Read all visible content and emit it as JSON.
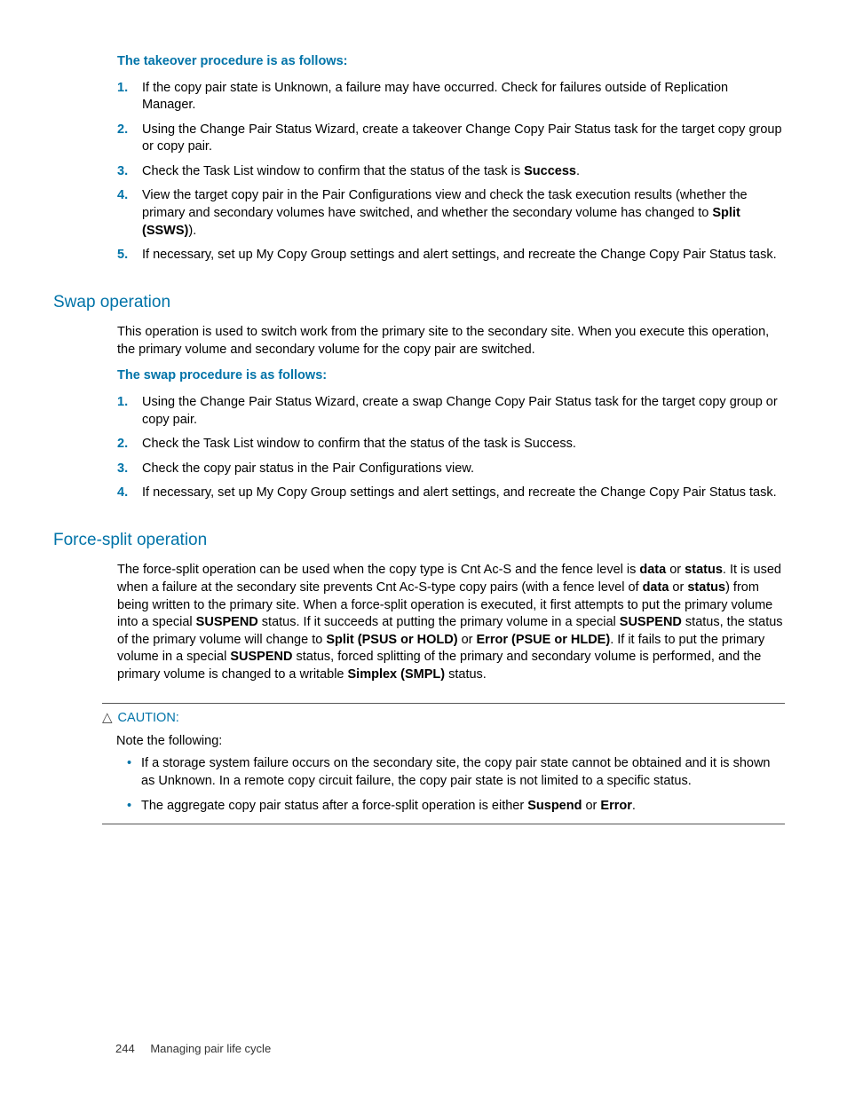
{
  "takeover": {
    "intro": "The takeover procedure is as follows:",
    "steps": [
      "If the copy pair state is Unknown, a failure may have occurred. Check for failures outside of Replication Manager.",
      "Using the Change Pair Status Wizard, create a takeover Change Copy Pair Status task for the target copy group or copy pair.",
      {
        "pre": "Check the Task List window to confirm that the status of the task is ",
        "b1": "Success",
        "post": "."
      },
      {
        "pre": "View the target copy pair in the Pair Configurations view and check the task execution results (whether the primary and secondary volumes have switched, and whether the secondary volume has changed to ",
        "b1": "Split (SSWS)",
        "post": ")."
      },
      "If necessary, set up My Copy Group settings and alert settings, and recreate the Change Copy Pair Status task."
    ]
  },
  "swap": {
    "heading": "Swap operation",
    "desc": "This operation is used to switch work from the primary site to the secondary site. When you execute this operation, the primary volume and secondary volume for the copy pair are switched.",
    "intro": "The swap procedure is as follows:",
    "steps": [
      "Using the Change Pair Status Wizard, create a swap Change Copy Pair Status task for the target copy group or copy pair.",
      "Check the Task List window to confirm that the status of the task is Success.",
      "Check the copy pair status in the Pair Configurations view.",
      "If necessary, set up My Copy Group settings and alert settings, and recreate the Change Copy Pair Status task."
    ]
  },
  "force": {
    "heading": "Force-split operation",
    "para": {
      "t1": "The force-split operation can be used when the copy type is Cnt Ac-S and the fence level is ",
      "b1": "data",
      "t2": " or ",
      "b2": "status",
      "t3": ". It is used when a failure at the secondary site prevents Cnt Ac-S-type copy pairs (with a fence level of ",
      "b3": "data",
      "t4": " or ",
      "b4": "status",
      "t5": ") from being written to the primary site. When a force-split operation is executed, it first attempts to put the primary volume into a special ",
      "b5": "SUSPEND",
      "t6": " status. If it succeeds at putting the primary volume in a special ",
      "b6": "SUSPEND",
      "t7": " status, the status of the primary volume will change to ",
      "b7": "Split (PSUS or HOLD)",
      "t8": " or ",
      "b8": "Error (PSUE or HLDE)",
      "t9": ". If it fails to put the primary volume in a special ",
      "b9": "SUSPEND",
      "t10": " status, forced splitting of the primary and secondary volume is performed, and the primary volume is changed to a writable ",
      "b10": "Simplex (SMPL)",
      "t11": " status."
    }
  },
  "caution": {
    "label": "CAUTION:",
    "note": "Note the following:",
    "bullets": [
      "If a storage system failure occurs on the secondary site, the copy pair state cannot be obtained and it is shown as Unknown. In a remote copy circuit failure, the copy pair state is not limited to a specific status.",
      {
        "pre": "The aggregate copy pair status after a force-split operation is either ",
        "b1": "Suspend",
        "mid": " or ",
        "b2": "Error",
        "post": "."
      }
    ]
  },
  "footer": {
    "page": "244",
    "title": "Managing pair life cycle"
  }
}
